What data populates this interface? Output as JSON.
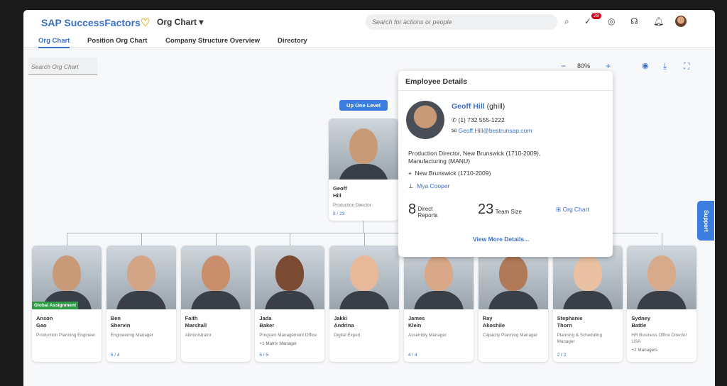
{
  "header": {
    "brand": "SAP SuccessFactors",
    "app_menu": "Org Chart",
    "search_placeholder": "Search for actions or people",
    "notification_count": "28"
  },
  "tabs": [
    {
      "label": "Org Chart"
    },
    {
      "label": "Position Org Chart"
    },
    {
      "label": "Company Structure Overview"
    },
    {
      "label": "Directory"
    }
  ],
  "toolbar": {
    "search_placeholder": "Search Org Chart",
    "zoom": "80%",
    "zoom_out": "−",
    "zoom_in": "+"
  },
  "up_one_level": "Up One Level",
  "focus": {
    "first": "Geoff",
    "last": "Hill",
    "title": "Production Director",
    "count": "8 / 23"
  },
  "details": {
    "heading": "Employee Details",
    "name": "Geoff Hill",
    "userid": "(ghill)",
    "phone": "(1) 732 555-1222",
    "email": "Geoff.Hill@bestrunsap.com",
    "position": "Production Director, New Brunswick (1710-2009), Manufacturing (MANU)",
    "location": "New Brunswick (1710-2009)",
    "manager": "Mya Cooper",
    "direct_reports": "8",
    "direct_reports_label": "Direct Reports",
    "team_size": "23",
    "team_size_label": "Team Size",
    "org_chart_link": "Org Chart",
    "view_more": "View More Details..."
  },
  "reports": [
    {
      "first": "Anson",
      "last": "Gao",
      "title": "Production Planning Engineer",
      "tag": "Global Assignment",
      "extra": "",
      "count": "",
      "skin": "#c99a78"
    },
    {
      "first": "Ben",
      "last": "Shervin",
      "title": "Engineering Manager",
      "tag": "",
      "extra": "",
      "count": "5 / 4",
      "skin": "#d3a486"
    },
    {
      "first": "Faith",
      "last": "Marshall",
      "title": "Administrator",
      "tag": "",
      "extra": "",
      "count": "",
      "skin": "#c98f6c"
    },
    {
      "first": "Jada",
      "last": "Baker",
      "title": "Program Management Office",
      "tag": "",
      "extra": "+1 Matrix Manager",
      "count": "5 / 5",
      "skin": "#7a4a32"
    },
    {
      "first": "Jakki",
      "last": "Andrina",
      "title": "Digital Expert",
      "tag": "",
      "extra": "",
      "count": "",
      "skin": "#e8b89a"
    },
    {
      "first": "James",
      "last": "Klein",
      "title": "Assembly Manager",
      "tag": "",
      "extra": "",
      "count": "4 / 4",
      "skin": "#d9a888"
    },
    {
      "first": "Ray",
      "last": "Akoshile",
      "title": "Capacity Planning Manager",
      "tag": "",
      "extra": "",
      "count": "",
      "skin": "#b07a58"
    },
    {
      "first": "Stephanie",
      "last": "Thorn",
      "title": "Planning & Scheduling Manager",
      "tag": "",
      "extra": "",
      "count": "2 / 2",
      "skin": "#eac1a2"
    },
    {
      "first": "Sydney",
      "last": "Battle",
      "title": "HR Business Office Director USA",
      "tag": "",
      "extra": "+2 Managers",
      "count": "",
      "skin": "#d8aa8c"
    }
  ],
  "support": "Support"
}
